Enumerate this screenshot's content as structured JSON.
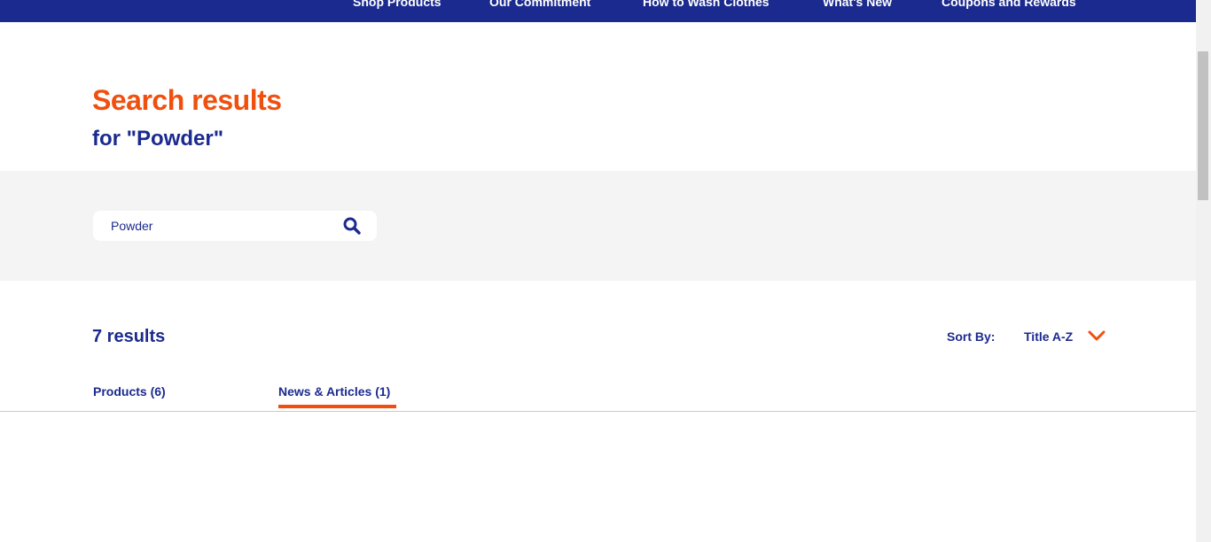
{
  "nav": {
    "items": [
      {
        "label": "Shop Products"
      },
      {
        "label": "Our Commitment"
      },
      {
        "label": "How to Wash Clothes"
      },
      {
        "label": "What's New"
      },
      {
        "label": "Coupons and Rewards"
      }
    ]
  },
  "header": {
    "title": "Search results",
    "subtitle": "for \"Powder\""
  },
  "search": {
    "value": "Powder",
    "icon": "search-icon"
  },
  "results": {
    "count_label": "7 results",
    "sort_label": "Sort By:",
    "sort_value": "Title A-Z",
    "sort_icon": "chevron-down-icon"
  },
  "tabs": [
    {
      "label": "Products (6)",
      "active": false
    },
    {
      "label": "News & Articles (1)",
      "active": true
    }
  ],
  "colors": {
    "brand_blue": "#1b2a8f",
    "accent_orange": "#f0500f",
    "band_gray": "#f4f4f4"
  }
}
